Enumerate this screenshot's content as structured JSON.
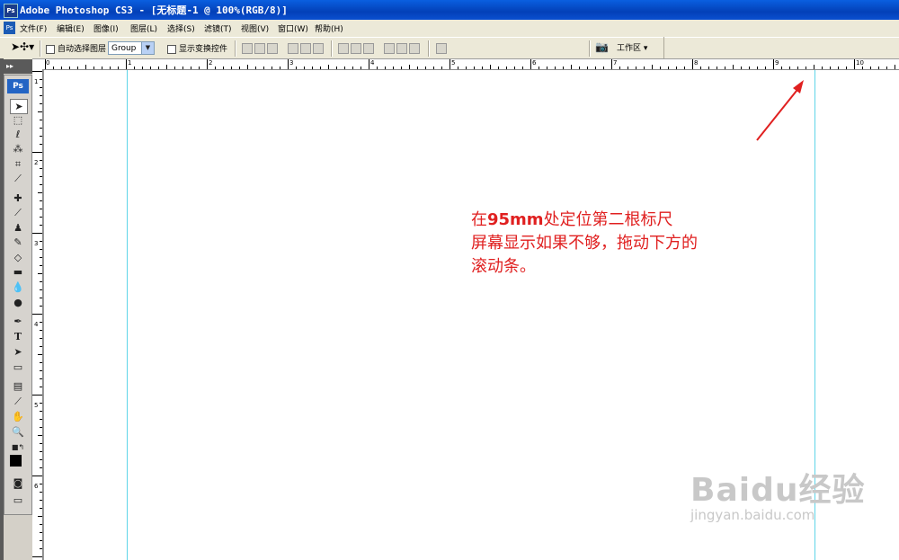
{
  "window": {
    "title": "Adobe Photoshop CS3 - [无标题-1 @ 100%(RGB/8)]"
  },
  "menu": [
    "文件(F)",
    "编辑(E)",
    "图像(I)",
    "图层(L)",
    "选择(S)",
    "滤镜(T)",
    "视图(V)",
    "窗口(W)",
    "帮助(H)"
  ],
  "options": {
    "auto_select_label": "自动选择图层",
    "group_value": "Group",
    "show_transform_label": "显示变换控件",
    "workspace_label": "工作区"
  },
  "toolbox": {
    "badge": "Ps",
    "tools": [
      "move-tool",
      "marquee-tool",
      "lasso-tool",
      "magic-wand-tool",
      "crop-tool",
      "slice-tool",
      "healing-brush-tool",
      "brush-tool",
      "clone-stamp-tool",
      "history-brush-tool",
      "eraser-tool",
      "gradient-tool",
      "blur-tool",
      "dodge-tool",
      "pen-tool",
      "type-tool",
      "path-selection-tool",
      "shape-tool",
      "notes-tool",
      "eyedropper-tool",
      "hand-tool",
      "zoom-tool"
    ]
  },
  "ruler": {
    "h_labels": [
      "0",
      "1",
      "2",
      "3",
      "4",
      "5",
      "6",
      "7",
      "8",
      "9",
      "10"
    ],
    "v_labels": [
      "1",
      "2",
      "3",
      "4",
      "5",
      "6"
    ]
  },
  "annotation": {
    "line1_prefix": "在",
    "line1_bold": "95mm",
    "line1_suffix": "处定位第二根标尺",
    "line2": "屏幕显示如果不够，拖动下方的",
    "line3": "滚动条。"
  },
  "watermark": {
    "brand": "Baidu经验",
    "url": "jingyan.baidu.com"
  },
  "colors": {
    "annotation": "#e02020",
    "guide": "#5fd5e8",
    "titlebar": "#0a4fd0"
  }
}
